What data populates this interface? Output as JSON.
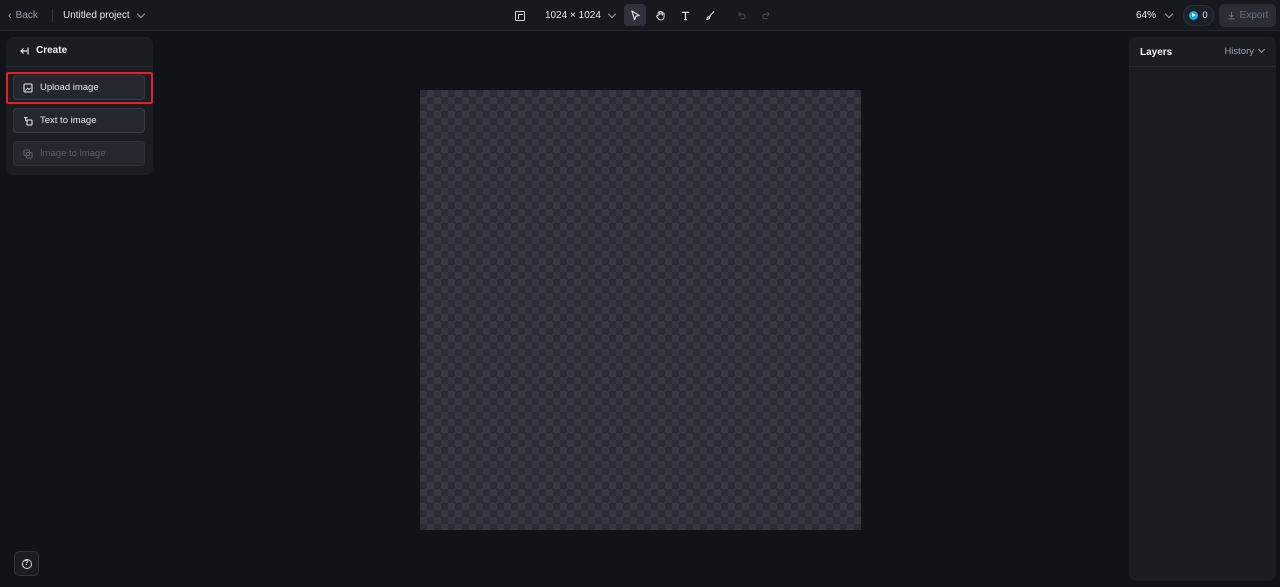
{
  "topbar": {
    "back_label": "Back",
    "project_title": "Untitled project",
    "canvas_size": "1024 × 1024",
    "zoom": "64%",
    "credits": "0",
    "export_label": "Export",
    "tools": [
      {
        "name": "select-tool",
        "icon": "cursor-arrow-icon",
        "active": true
      },
      {
        "name": "hand-tool",
        "icon": "hand-icon",
        "active": false
      },
      {
        "name": "text-tool",
        "icon": "text-t-icon",
        "active": false
      },
      {
        "name": "brush-tool",
        "icon": "brush-icon",
        "active": false
      },
      {
        "name": "undo-button",
        "icon": "undo-icon",
        "active": false
      },
      {
        "name": "redo-button",
        "icon": "redo-icon",
        "active": false
      }
    ]
  },
  "create_panel": {
    "title": "Create",
    "items": [
      {
        "label": "Upload image",
        "enabled": true,
        "icon": "upload-image-icon"
      },
      {
        "label": "Text to image",
        "enabled": true,
        "icon": "text-to-image-icon"
      },
      {
        "label": "Image to image",
        "enabled": false,
        "icon": "image-to-image-icon"
      }
    ]
  },
  "right_panel": {
    "layers_title": "Layers",
    "history_label": "History"
  },
  "colors": {
    "background": "#111318",
    "panel": "#1b1d23",
    "highlight": "#e0202a",
    "accent": "#1ea7e8"
  }
}
